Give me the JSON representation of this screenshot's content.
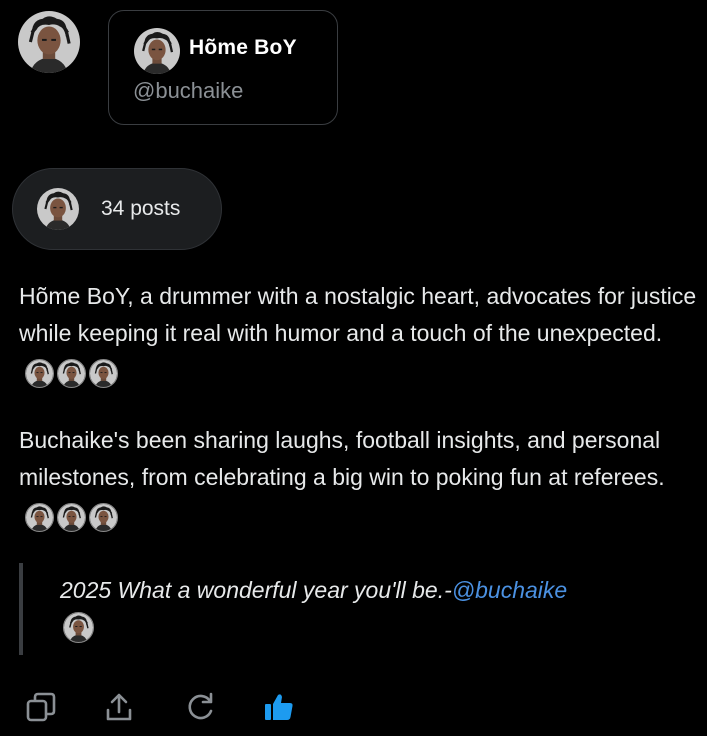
{
  "profile": {
    "name": "Hõme BoY",
    "handle": "@buchaike",
    "avatar_icon": "profile-avatar"
  },
  "posts": {
    "count_label": "34 posts"
  },
  "summary": {
    "paragraph_1": "Hõme BoY, a drummer with a nostalgic heart, advocates for justice while keeping it real with humor and a touch of the unexpected.",
    "paragraph_2": "Buchaike's been sharing laughs, football insights, and personal milestones, from celebrating a big win to poking fun at referees."
  },
  "quote": {
    "text": "2025 What a wonderful year you'll be.-",
    "mention": "@buchaike"
  },
  "actions": [
    {
      "name": "copy",
      "icon": "copy-icon"
    },
    {
      "name": "share",
      "icon": "share-icon"
    },
    {
      "name": "regenerate",
      "icon": "refresh-icon"
    },
    {
      "name": "like",
      "icon": "thumbs-up-icon"
    }
  ],
  "colors": {
    "background": "#000000",
    "text": "#e7e9ea",
    "muted": "#8b9095",
    "mention": "#4b91e2",
    "like": "#1d9bf0"
  }
}
